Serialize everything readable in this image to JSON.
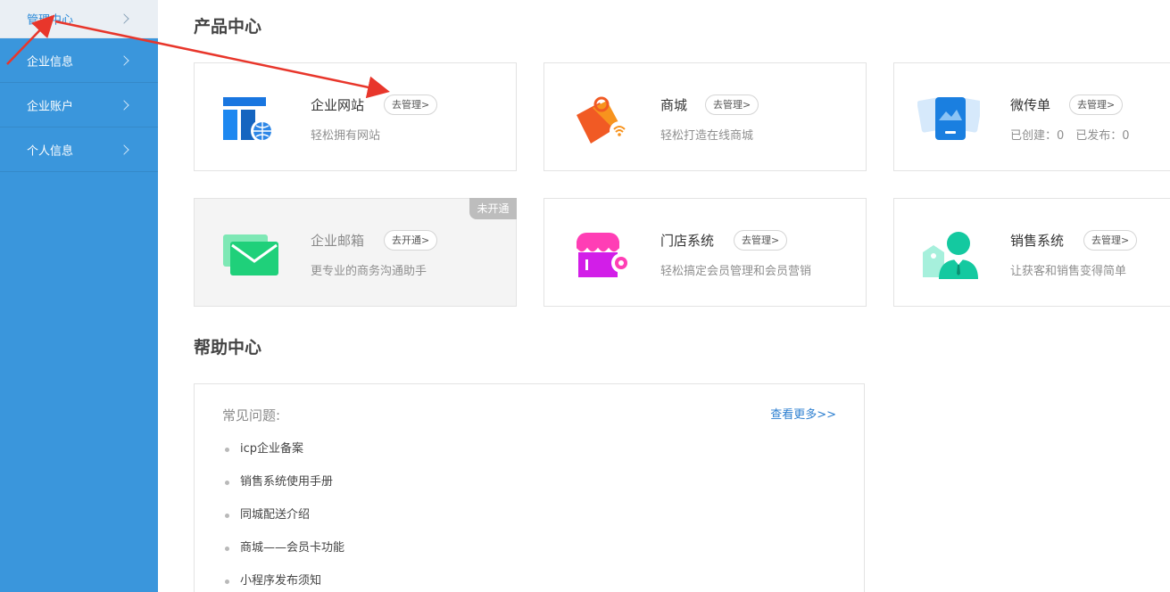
{
  "sidebar": {
    "items": [
      {
        "label": "管理中心",
        "active": true
      },
      {
        "label": "企业信息"
      },
      {
        "label": "企业账户"
      },
      {
        "label": "个人信息"
      }
    ]
  },
  "product_center": {
    "title": "产品中心",
    "cards": [
      {
        "name": "企业网站",
        "action": "去管理>",
        "desc": "轻松拥有网站"
      },
      {
        "name": "商城",
        "action": "去管理>",
        "desc": "轻松打造在线商城"
      },
      {
        "name": "微传单",
        "action": "去管理>",
        "desc": "已创建：0　已发布：0"
      },
      {
        "name": "企业邮箱",
        "action": "去开通>",
        "desc": "更专业的商务沟通助手",
        "badge": "未开通"
      },
      {
        "name": "门店系统",
        "action": "去管理>",
        "desc": "轻松搞定会员管理和会员营销"
      },
      {
        "name": "销售系统",
        "action": "去管理>",
        "desc": "让获客和销售变得简单"
      }
    ]
  },
  "help_center": {
    "title": "帮助中心",
    "faq_label": "常见问题:",
    "more_link": "查看更多>>",
    "items": [
      "icp企业备案",
      "销售系统使用手册",
      "同城配送介绍",
      "商城——会员卡功能",
      "小程序发布须知"
    ]
  },
  "colors": {
    "sidebar_bg": "#3a96dc",
    "active_text": "#2d8bd8",
    "link": "#2d7fd0",
    "annotation_arrow": "#e8362b"
  }
}
